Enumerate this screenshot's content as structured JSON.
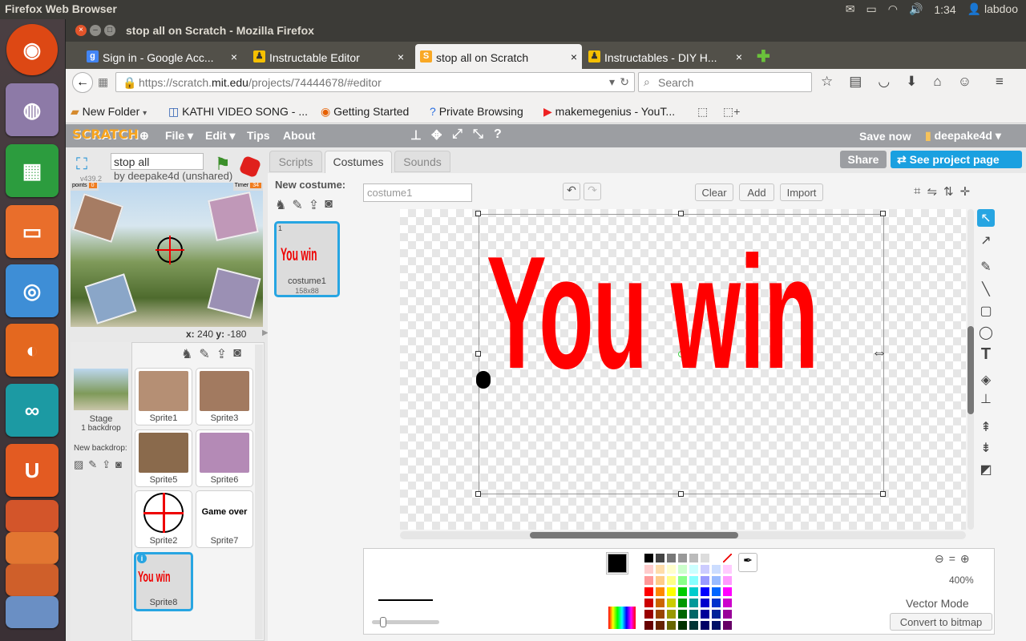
{
  "os": {
    "app_title": "Firefox Web Browser",
    "time": "1:34",
    "user": "labdoo"
  },
  "window": {
    "title": "stop all on Scratch - Mozilla Firefox"
  },
  "tabs": [
    {
      "label": "Sign in - Google Acc...",
      "icon": "google-icon"
    },
    {
      "label": "Instructable Editor",
      "icon": "instructables-icon"
    },
    {
      "label": "stop all on Scratch",
      "icon": "scratch-icon"
    },
    {
      "label": "Instructables - DIY H...",
      "icon": "instructables-icon"
    }
  ],
  "nav": {
    "url_prefix": "https://scratch.",
    "url_domain": "mit.edu",
    "url_path": "/projects/74444678/#editor",
    "search_placeholder": "Search"
  },
  "bookmarks": [
    {
      "label": "New Folder",
      "icon": "folder-icon"
    },
    {
      "label": "KATHI VIDEO SONG - ...",
      "icon": "video-icon"
    },
    {
      "label": "Getting Started",
      "icon": "firefox-icon"
    },
    {
      "label": "Private Browsing",
      "icon": "help-icon"
    },
    {
      "label": "makemegenius - YouT...",
      "icon": "youtube-icon"
    }
  ],
  "scratch_menu": {
    "logo": "SCRATCH",
    "file": "File",
    "edit": "Edit",
    "tips": "Tips",
    "about": "About",
    "save_now": "Save now",
    "username": "deepake4d"
  },
  "project": {
    "title": "stop all",
    "author": "by deepake4d (unshared)",
    "version": "v439.2",
    "share": "Share",
    "see_project": "See project page",
    "stage_x": "240",
    "stage_y": "-180",
    "x_label": "x:",
    "y_label": "y:",
    "points_label": "points",
    "points_value": "0",
    "timer_label": "Timer",
    "timer_value": "34"
  },
  "editor_tabs": {
    "scripts": "Scripts",
    "costumes": "Costumes",
    "sounds": "Sounds"
  },
  "costumes": {
    "new_costume": "New costume:",
    "list": [
      {
        "index": "1",
        "name": "costume1",
        "size": "158x88",
        "text": "You win"
      }
    ]
  },
  "paint": {
    "costume_name": "costume1",
    "clear": "Clear",
    "add": "Add",
    "import": "Import",
    "canvas_text": "You win",
    "zoom": "400%",
    "mode": "Vector Mode",
    "convert": "Convert to bitmap",
    "text_color": "#ff0000"
  },
  "sprites": {
    "stage_label": "Stage",
    "stage_sub": "1 backdrop",
    "new_backdrop": "New backdrop:",
    "items": [
      {
        "name": "Sprite1"
      },
      {
        "name": "Sprite3"
      },
      {
        "name": "Sprite5"
      },
      {
        "name": "Sprite6"
      },
      {
        "name": "Sprite2"
      },
      {
        "name": "Sprite7",
        "text": "Game over"
      },
      {
        "name": "Sprite8",
        "text": "You win"
      }
    ]
  }
}
